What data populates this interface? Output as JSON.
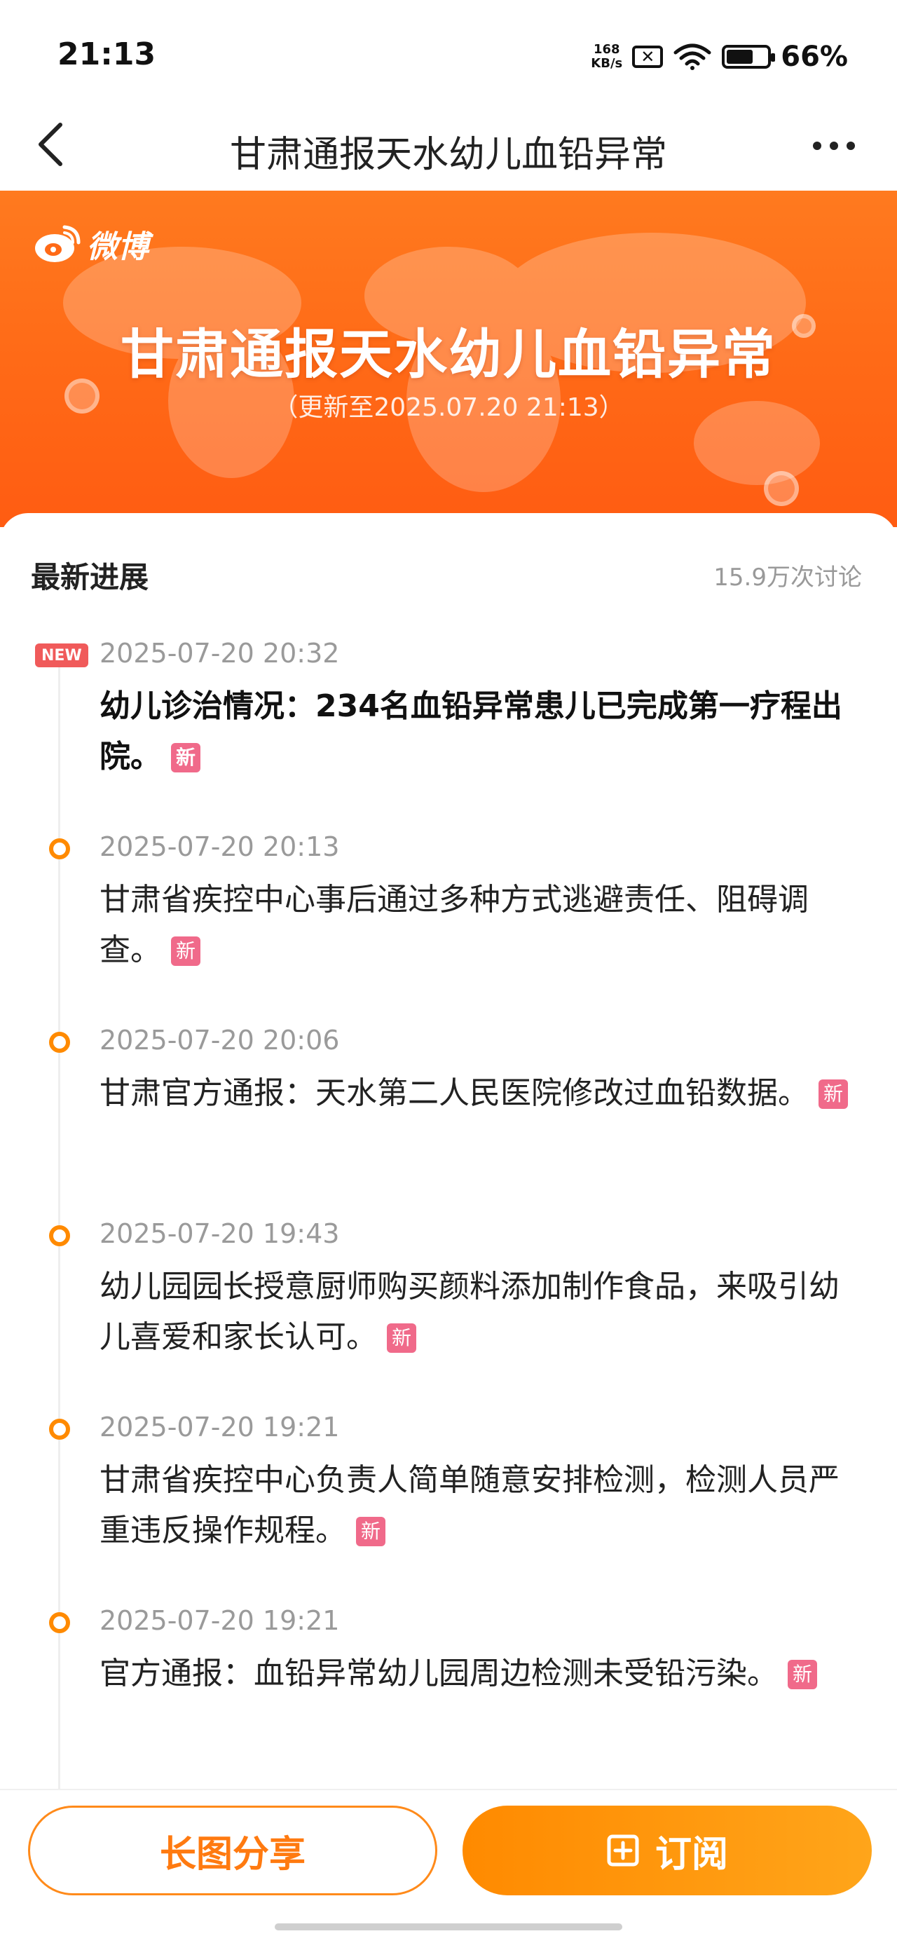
{
  "status_bar": {
    "time": "21:13",
    "net_speed_value": "168",
    "net_speed_unit": "KB/s",
    "battery_pct": "66%",
    "battery_level": 0.66
  },
  "nav": {
    "title": "甘肃通报天水幼儿血铅异常"
  },
  "banner": {
    "logo_text": "微博",
    "title": "甘肃通报天水幼儿血铅异常",
    "subtitle": "（更新至2025.07.20 21:13）",
    "color_start": "#ff7a1f",
    "color_end": "#ff5c12"
  },
  "section": {
    "title": "最新进展",
    "discussion_count": "15.9万次讨论"
  },
  "entries": [
    {
      "badge": "NEW",
      "time": "2025-07-20 20:32",
      "text": "幼儿诊治情况：234名血铅异常患儿已完成第一疗程出院。",
      "tag": "新"
    },
    {
      "time": "2025-07-20 20:13",
      "text": "甘肃省疾控中心事后通过多种方式逃避责任、阻碍调查。",
      "tag": "新"
    },
    {
      "time": "2025-07-20 20:06",
      "text": "甘肃官方通报：天水第二人民医院修改过血铅数据。",
      "tag": "新"
    },
    {
      "time": "2025-07-20 19:43",
      "text": "幼儿园园长授意厨师购买颜料添加制作食品，来吸引幼儿喜爱和家长认可。",
      "tag": "新"
    },
    {
      "time": "2025-07-20 19:21",
      "text": "甘肃省疾控中心负责人简单随意安排检测，检测人员严重违反操作规程。",
      "tag": "新"
    },
    {
      "time": "2025-07-20 19:21",
      "text": "官方通报：血铅异常幼儿园周边检测未受铅污染。",
      "tag": "新"
    }
  ],
  "bottom_bar": {
    "share_label": "长图分享",
    "subscribe_label": "订阅",
    "accent": "#ff8a00"
  }
}
